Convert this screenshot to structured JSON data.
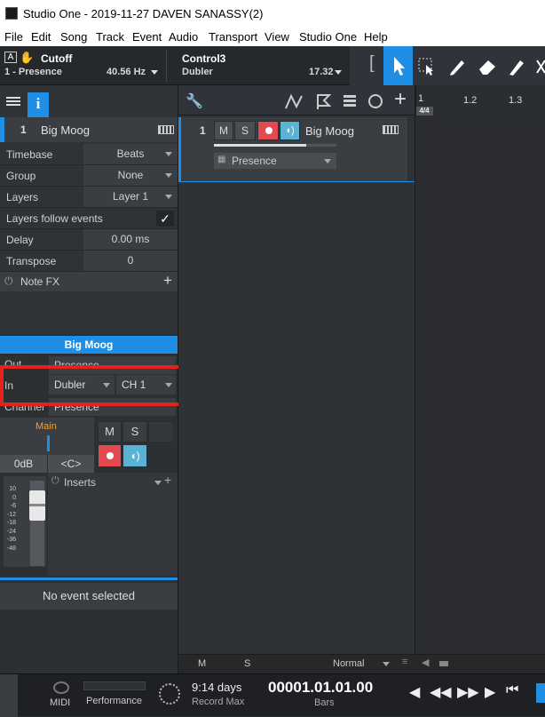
{
  "window": {
    "title": "Studio One - 2019-11-27 DAVEN SANASSY(2)"
  },
  "menu": [
    "File",
    "Edit",
    "Song",
    "Track",
    "Event",
    "Audio",
    "Transport",
    "View",
    "Studio One",
    "Help"
  ],
  "toolbar": {
    "control1": {
      "icon": "A",
      "name": "Cutoff",
      "sub": "1 - Presence",
      "value": "40.56 Hz"
    },
    "control2": {
      "name": "Control3",
      "sub": "Dubler",
      "value": "17.32"
    },
    "tools": [
      "arrow-tool-icon",
      "range-tool-icon",
      "pencil-tool-icon",
      "eraser-tool-icon",
      "paint-tool-icon",
      "mute-tool-icon"
    ]
  },
  "inspector": {
    "track_number": "1",
    "track_name": "Big Moog",
    "rows": [
      {
        "label": "Timebase",
        "value": "Beats"
      },
      {
        "label": "Group",
        "value": "None"
      },
      {
        "label": "Layers",
        "value": "Layer 1"
      },
      {
        "label": "Layers follow events",
        "value": ""
      },
      {
        "label": "Delay",
        "value": "0.00 ms"
      },
      {
        "label": "Transpose",
        "value": "0"
      }
    ],
    "note_fx": "Note FX"
  },
  "channel": {
    "name": "Big Moog",
    "out_label": "Out",
    "out_value": "Presence",
    "in_label": "In",
    "in_device": "Dubler",
    "in_channel": "CH 1",
    "channel_label": "Channel",
    "channel_value": "Presence",
    "main": "Main",
    "volume": "0dB",
    "pan": "<C>",
    "mute": "M",
    "solo": "S",
    "inserts": "Inserts",
    "meter_scale": [
      "10",
      "0",
      "-6",
      "-12",
      "-18",
      "-24",
      "-36",
      "-48"
    ],
    "no_event": "No event selected"
  },
  "track": {
    "number": "1",
    "mute": "M",
    "solo": "S",
    "name": "Big Moog",
    "output": "Presence"
  },
  "ruler": {
    "marks": [
      "1",
      "1.2",
      "1.3"
    ],
    "signature": "4/4"
  },
  "arrange_footer": {
    "mute": "M",
    "solo": "S",
    "mode": "Normal"
  },
  "transport": {
    "midi": "MIDI",
    "performance": "Performance",
    "record_time": "9:14 days",
    "record_label": "Record Max",
    "position": "00001.01.01.00",
    "position_unit": "Bars"
  },
  "colors": {
    "accent": "#1f8fe6",
    "record": "#e24a4f",
    "monitor": "#5ab3d4",
    "highlight": "#e3231c"
  }
}
